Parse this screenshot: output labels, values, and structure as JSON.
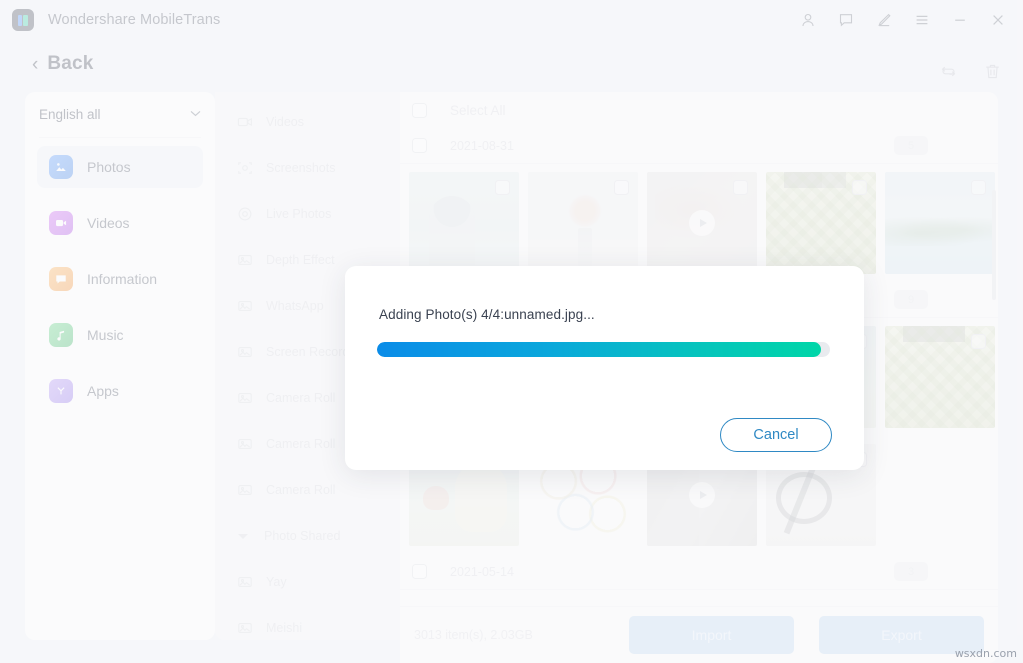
{
  "window": {
    "app_title": "Wondershare MobileTrans",
    "controls": [
      {
        "name": "account-icon",
        "label": "Account"
      },
      {
        "name": "feedback-icon",
        "label": "Feedback"
      },
      {
        "name": "edit-icon",
        "label": "Edit"
      },
      {
        "name": "menu-icon",
        "label": "Menu"
      },
      {
        "name": "minimize-icon",
        "label": "Minimize"
      },
      {
        "name": "close-icon",
        "label": "Close"
      }
    ]
  },
  "header": {
    "back_label": "Back",
    "back_chevron": "‹",
    "tools": [
      {
        "name": "refresh-icon",
        "label": "Refresh"
      },
      {
        "name": "delete-icon",
        "label": "Delete"
      }
    ]
  },
  "sidebar": {
    "language_label": "English all",
    "caret": "⌄",
    "items": [
      {
        "label": "Photos",
        "icon": "photos-icon",
        "active": true
      },
      {
        "label": "Videos",
        "icon": "videos-icon",
        "active": false
      },
      {
        "label": "Information",
        "icon": "information-icon",
        "active": false
      },
      {
        "label": "Music",
        "icon": "music-icon",
        "active": false
      },
      {
        "label": "Apps",
        "icon": "apps-icon",
        "active": false
      }
    ]
  },
  "albums": {
    "items": [
      {
        "label": "Videos",
        "icon": "video-camera-icon",
        "type": "album"
      },
      {
        "label": "Screenshots",
        "icon": "screenshot-icon",
        "type": "album"
      },
      {
        "label": "Live Photos",
        "icon": "live-photo-icon",
        "type": "album"
      },
      {
        "label": "Depth Effect",
        "icon": "photo-icon",
        "type": "album"
      },
      {
        "label": "WhatsApp",
        "icon": "photo-icon",
        "type": "album"
      },
      {
        "label": "Screen Recorder",
        "icon": "photo-icon",
        "type": "album"
      },
      {
        "label": "Camera Roll",
        "icon": "photo-icon",
        "type": "album"
      },
      {
        "label": "Camera Roll",
        "icon": "photo-icon",
        "type": "album"
      },
      {
        "label": "Camera Roll",
        "icon": "photo-icon",
        "type": "album"
      },
      {
        "label": "Photo Shared",
        "icon": "caret-down-icon",
        "type": "group"
      },
      {
        "label": "Yay",
        "icon": "photo-icon",
        "type": "album"
      },
      {
        "label": "Meishi",
        "icon": "photo-icon",
        "type": "album"
      }
    ]
  },
  "content": {
    "select_all_label": "Select All",
    "groups": [
      {
        "date": "2021-08-31",
        "count": "5"
      },
      {
        "date": "",
        "count": "9"
      },
      {
        "date": "2021-05-14",
        "count": "3"
      }
    ],
    "rows": [
      [
        {
          "name": "thumb-person",
          "kind": "photo"
        },
        {
          "name": "thumb-flowers",
          "kind": "photo"
        },
        {
          "name": "thumb-video-1",
          "kind": "video"
        },
        {
          "name": "thumb-hedge",
          "kind": "photo"
        },
        {
          "name": "thumb-beach",
          "kind": "photo"
        }
      ],
      [
        {
          "name": "thumb-cat-drawing",
          "kind": "photo"
        },
        {
          "name": "thumb-chart",
          "kind": "photo"
        },
        {
          "name": "thumb-video-2",
          "kind": "video"
        },
        {
          "name": "thumb-cable",
          "kind": "photo"
        }
      ]
    ]
  },
  "bottombar": {
    "item_stat": "3013 item(s), 2.03GB",
    "import_label": "Import",
    "export_label": "Export"
  },
  "dialog": {
    "message": "Adding Photo(s) 4/4:unnamed.jpg...",
    "progress_percent": 98,
    "cancel_label": "Cancel",
    "progress_color_start": "#0a8ce8",
    "progress_color_end": "#00d6a8",
    "accent_color": "#2f89c4"
  },
  "watermark": "wsxdn.com"
}
